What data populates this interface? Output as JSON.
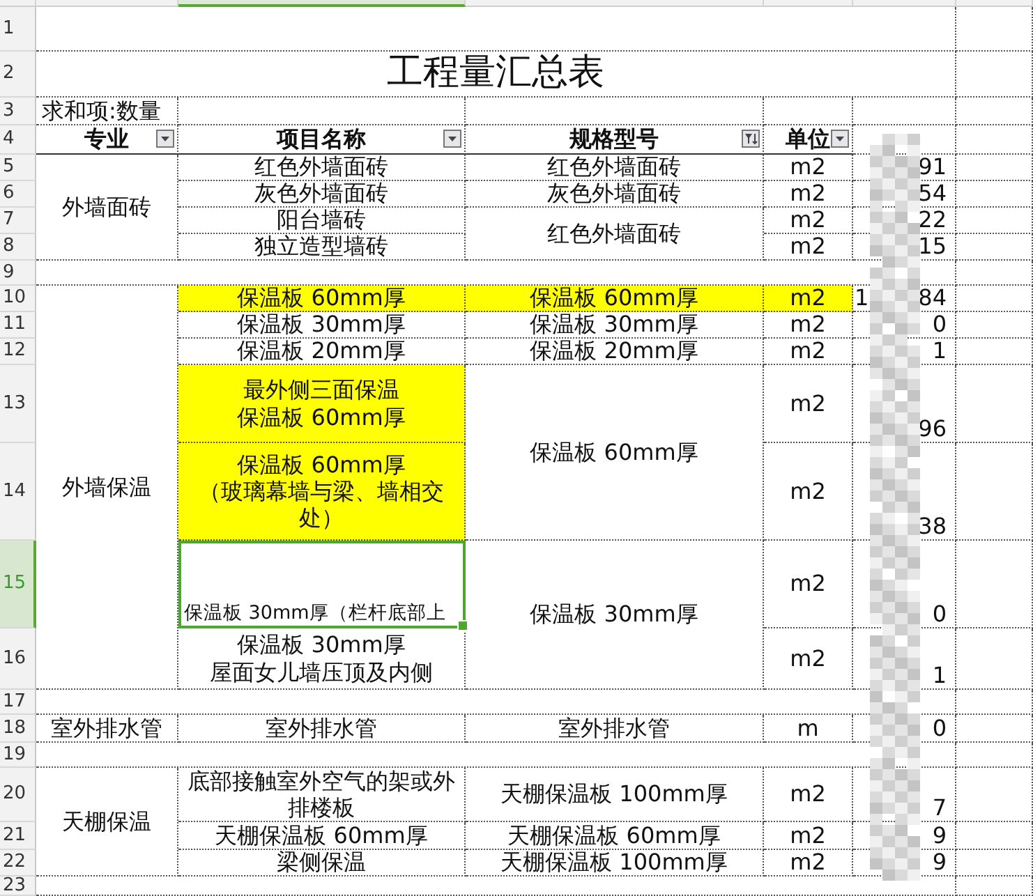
{
  "row_headers": [
    {
      "label": "1",
      "selected": false
    },
    {
      "label": "2",
      "selected": false
    },
    {
      "label": "3",
      "selected": false
    },
    {
      "label": "4",
      "selected": false
    },
    {
      "label": "5",
      "selected": false
    },
    {
      "label": "6",
      "selected": false
    },
    {
      "label": "7",
      "selected": false
    },
    {
      "label": "8",
      "selected": false
    },
    {
      "label": "9",
      "selected": false
    },
    {
      "label": "10",
      "selected": false
    },
    {
      "label": "11",
      "selected": false
    },
    {
      "label": "12",
      "selected": false
    },
    {
      "label": "13",
      "selected": false
    },
    {
      "label": "14",
      "selected": false
    },
    {
      "label": "15",
      "selected": true
    },
    {
      "label": "16",
      "selected": false
    },
    {
      "label": "17",
      "selected": false
    },
    {
      "label": "18",
      "selected": false
    },
    {
      "label": "19",
      "selected": false
    },
    {
      "label": "20",
      "selected": false
    },
    {
      "label": "21",
      "selected": false
    },
    {
      "label": "22",
      "selected": false
    },
    {
      "label": "23",
      "selected": false
    }
  ],
  "title": "工程量汇总表",
  "pivot_label": "求和项:数量",
  "columns": [
    {
      "label": "专业",
      "filtered": false
    },
    {
      "label": "项目名称",
      "filtered": false
    },
    {
      "label": "规格型号",
      "filtered": true
    },
    {
      "label": "单位",
      "filtered": false
    }
  ],
  "groups": [
    {
      "category": "外墙面砖",
      "spec_blocks": [
        {
          "spec": "红色外墙面砖",
          "items": [
            {
              "name_lines": [
                "红色外墙面砖"
              ],
              "unit": "m2",
              "total": "91",
              "name_highlighted": false,
              "row_highlighted": false,
              "selected": false
            }
          ]
        },
        {
          "spec": "灰色外墙面砖",
          "items": [
            {
              "name_lines": [
                "灰色外墙面砖"
              ],
              "unit": "m2",
              "total": "54",
              "name_highlighted": false,
              "row_highlighted": false,
              "selected": false
            }
          ]
        },
        {
          "spec": "红色外墙面砖",
          "items": [
            {
              "name_lines": [
                "阳台墙砖"
              ],
              "unit": "m2",
              "total": "22",
              "name_highlighted": false,
              "row_highlighted": false,
              "selected": false
            },
            {
              "name_lines": [
                "独立造型墙砖"
              ],
              "unit": "m2",
              "total": "15",
              "name_highlighted": false,
              "row_highlighted": false,
              "selected": false
            }
          ]
        }
      ]
    },
    {
      "category": "外墙保温",
      "spec_blocks": [
        {
          "spec": "保温板 60mm厚",
          "items": [
            {
              "name_lines": [
                "保温板 60mm厚"
              ],
              "unit": "m2",
              "total_prefix": "1",
              "total": "84",
              "name_highlighted": true,
              "row_highlighted": true,
              "selected": false
            }
          ]
        },
        {
          "spec": "保温板 30mm厚",
          "items": [
            {
              "name_lines": [
                "保温板 30mm厚"
              ],
              "unit": "m2",
              "total": "0",
              "name_highlighted": false,
              "row_highlighted": false,
              "selected": false
            }
          ]
        },
        {
          "spec": "保温板 20mm厚",
          "items": [
            {
              "name_lines": [
                "保温板 20mm厚"
              ],
              "unit": "m2",
              "total": "1",
              "name_highlighted": false,
              "row_highlighted": false,
              "selected": false
            }
          ]
        },
        {
          "spec": "保温板 60mm厚",
          "items": [
            {
              "name_lines": [
                "最外侧三面保温",
                "保温板 60mm厚"
              ],
              "unit": "m2",
              "total": "96",
              "name_highlighted": true,
              "row_highlighted": false,
              "selected": false
            },
            {
              "name_lines": [
                "保温板 60mm厚",
                "（玻璃幕墙与梁、墙相交处）"
              ],
              "unit": "m2",
              "total": "38",
              "name_highlighted": true,
              "row_highlighted": false,
              "selected": false
            }
          ]
        },
        {
          "spec": "保温板 30mm厚",
          "items": [
            {
              "name_lines": [
                "保温板 30mm厚（栏杆底部上"
              ],
              "unit": "m2",
              "total": "0",
              "name_highlighted": false,
              "row_highlighted": false,
              "selected": true
            },
            {
              "name_lines": [
                "保温板 30mm厚",
                "屋面女儿墙压顶及内侧"
              ],
              "unit": "m2",
              "total": "1",
              "name_highlighted": false,
              "row_highlighted": false,
              "selected": false
            }
          ]
        }
      ]
    },
    {
      "category": "室外排水管",
      "spec_blocks": [
        {
          "spec": "室外排水管",
          "items": [
            {
              "name_lines": [
                "室外排水管"
              ],
              "unit": "m",
              "total": "0",
              "name_highlighted": false,
              "row_highlighted": false,
              "selected": false
            }
          ]
        }
      ]
    },
    {
      "category": "天棚保温",
      "spec_blocks": [
        {
          "spec": "天棚保温板 100mm厚",
          "items": [
            {
              "name_lines": [
                "底部接触室外空气的架或外排楼板"
              ],
              "unit": "m2",
              "total": "7",
              "name_highlighted": false,
              "row_highlighted": false,
              "selected": false
            }
          ]
        },
        {
          "spec": "天棚保温板 60mm厚",
          "items": [
            {
              "name_lines": [
                "天棚保温板 60mm厚"
              ],
              "unit": "m2",
              "total": "9",
              "name_highlighted": false,
              "row_highlighted": false,
              "selected": false
            }
          ]
        },
        {
          "spec": "天棚保温板 100mm厚",
          "items": [
            {
              "name_lines": [
                "梁侧保温"
              ],
              "unit": "m2",
              "total": "9",
              "name_highlighted": false,
              "row_highlighted": false,
              "selected": false
            }
          ]
        }
      ]
    }
  ]
}
